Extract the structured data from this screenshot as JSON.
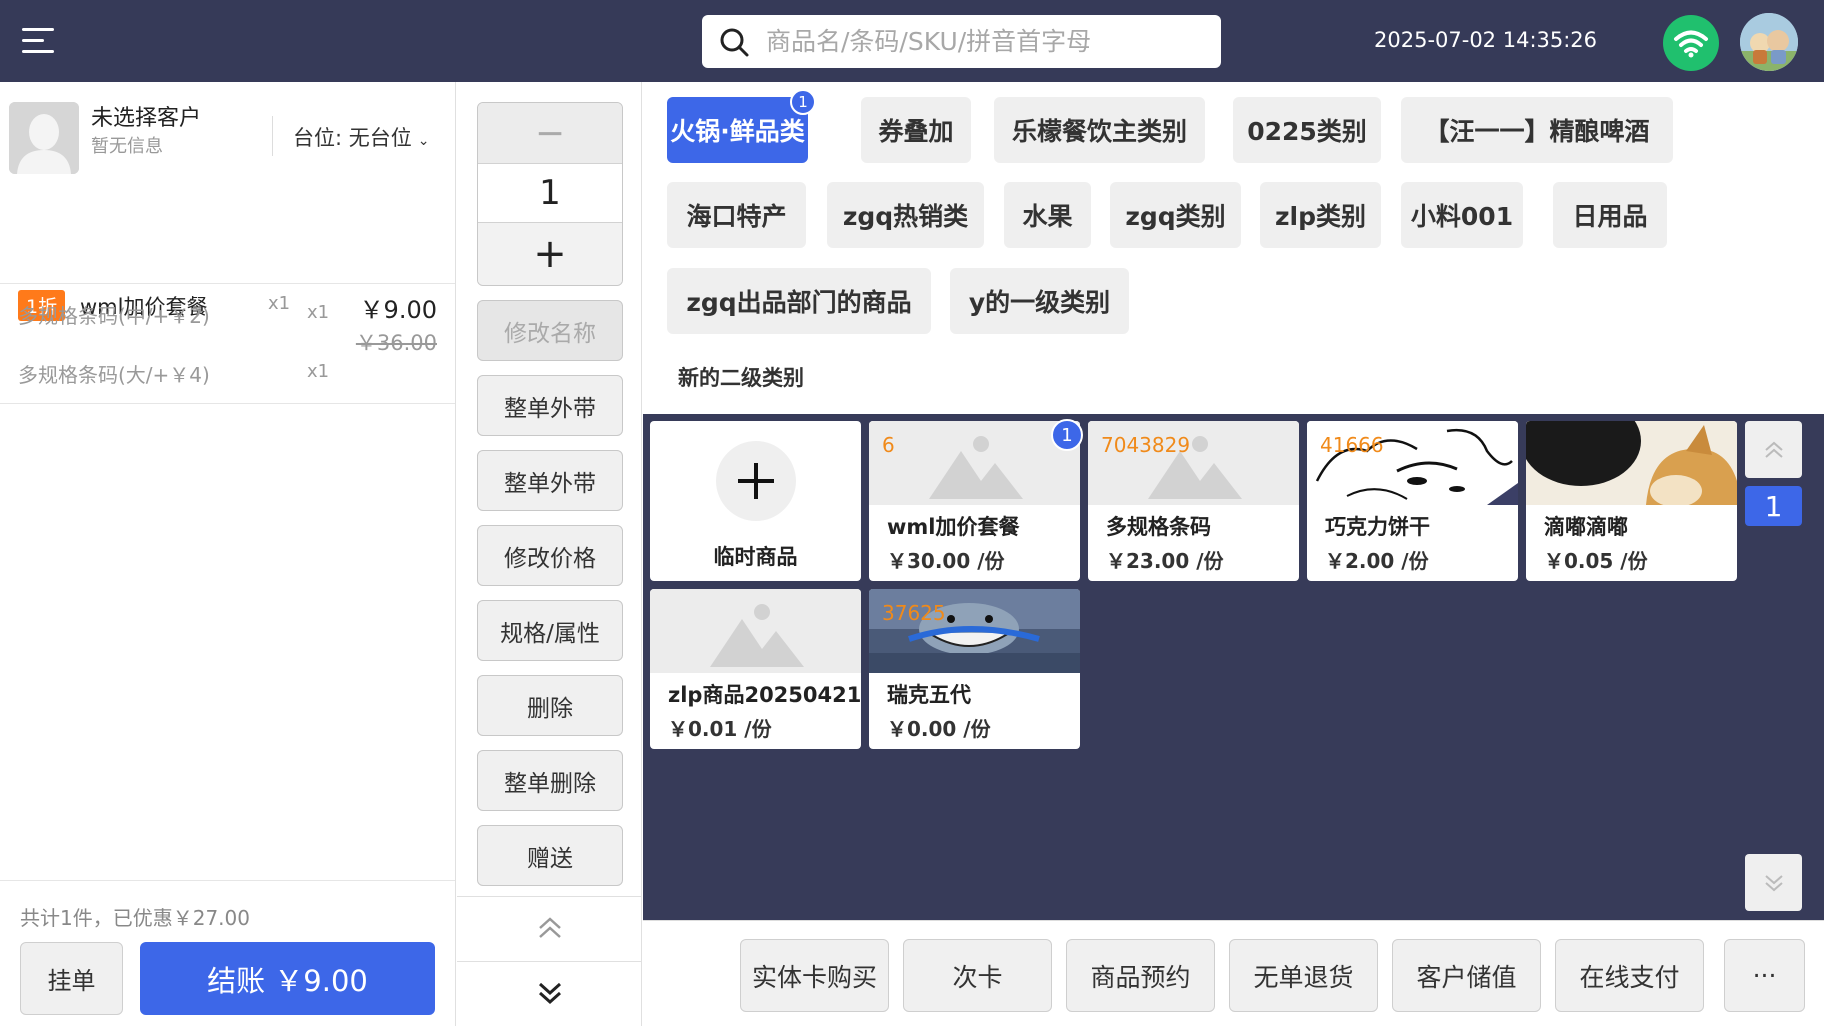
{
  "header": {
    "search_placeholder": "商品名/条码/SKU/拼音首字母",
    "datetime": "2025-07-02 14:35:26"
  },
  "customer": {
    "name": "未选择客户",
    "info": "暂无信息",
    "table_label": "台位: 无台位"
  },
  "cart": {
    "item": {
      "discount": "1折",
      "name": "wml加价套餐",
      "qty": "x1",
      "price": "￥9.00",
      "original_price": "￥36.00"
    },
    "sub_items": [
      {
        "name": "多规格条码(中/+￥2)",
        "qty": "x1"
      },
      {
        "name": "多规格条码(大/+￥4)",
        "qty": "x1"
      }
    ],
    "summary": "共计1件，已优惠￥27.00",
    "hold_label": "挂单",
    "checkout_label": "结账 ￥9.00"
  },
  "actions": {
    "minus": "−",
    "quantity": "1",
    "plus": "+",
    "buttons": [
      "修改名称",
      "整单外带",
      "整单外带",
      "修改价格",
      "规格/属性",
      "删除",
      "整单删除",
      "赠送"
    ]
  },
  "categories": [
    {
      "label": "火锅·鲜品类",
      "badge": "1",
      "active": true
    },
    {
      "label": "券叠加"
    },
    {
      "label": "乐檬餐饮主类别"
    },
    {
      "label": "0225类别"
    },
    {
      "label": "【汪一一】精酿啤酒"
    },
    {
      "label": "海口特产"
    },
    {
      "label": "zgq热销类"
    },
    {
      "label": "水果"
    },
    {
      "label": "zgq类别"
    },
    {
      "label": "zlp类别"
    },
    {
      "label": "小料001"
    },
    {
      "label": "日用品"
    },
    {
      "label": "zgq出品部门的商品"
    },
    {
      "label": "y的一级类别"
    }
  ],
  "subcategory": "新的二级类别",
  "temp_product_label": "临时商品",
  "products": [
    {
      "stock": "6",
      "name": "wml加价套餐",
      "price": "￥30.00 /份",
      "badge": "1",
      "image": "placeholder-image"
    },
    {
      "stock": "7043829",
      "name": "多规格条码",
      "price": "￥23.00 /份",
      "image": "placeholder-image"
    },
    {
      "stock": "41666",
      "name": "巧克力饼干",
      "price": "￥2.00 /份",
      "image": "cartoon-sketch-image"
    },
    {
      "stock": "",
      "name": "滴嘟滴嘟",
      "price": "￥0.05 /份",
      "image": "shiba-dog-image"
    },
    {
      "stock": "",
      "name": "zlp商品20250421",
      "price": "￥0.01 /份",
      "image": "placeholder-image"
    },
    {
      "stock": "37625",
      "name": "瑞克五代",
      "price": "￥0.00 /份",
      "image": "shark-figure-image"
    }
  ],
  "pagination": {
    "page": "1"
  },
  "bottom_buttons": [
    "实体卡购买",
    "次卡",
    "商品预约",
    "无单退货",
    "客户储值",
    "在线支付",
    "···"
  ],
  "colors": {
    "topbar": "#363a58",
    "accent": "#3d67e8",
    "discount": "#ff7a1a",
    "stock": "#f08a1a",
    "wifi": "#20c06e"
  }
}
